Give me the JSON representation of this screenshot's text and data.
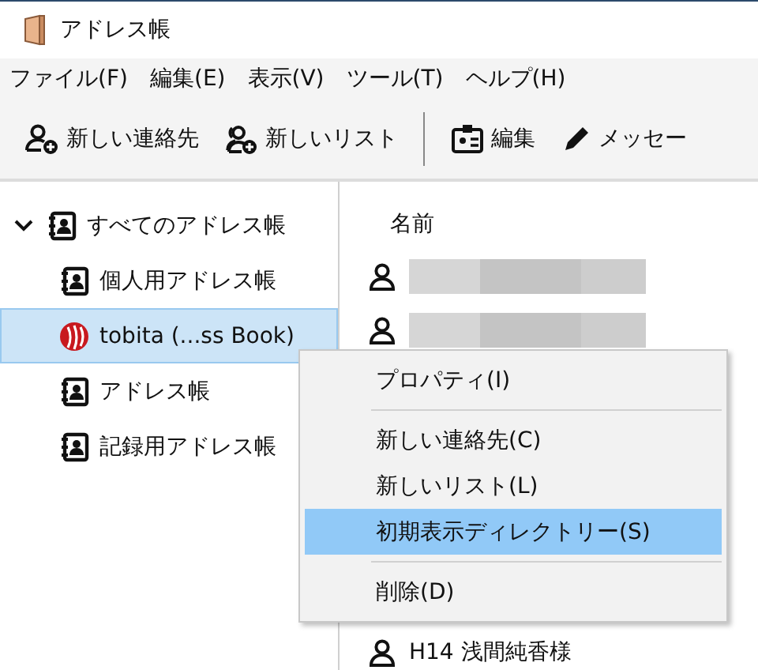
{
  "window": {
    "title": "アドレス帳"
  },
  "menu_bar": [
    "ファイル(F)",
    "編集(E)",
    "表示(V)",
    "ツール(T)",
    "ヘルプ(H)"
  ],
  "toolbar": [
    {
      "kind": "new-contact",
      "label": "新しい連絡先"
    },
    {
      "kind": "new-list",
      "label": "新しいリスト"
    },
    {
      "kind": "separator"
    },
    {
      "kind": "edit",
      "label": "編集"
    },
    {
      "kind": "message",
      "label": "メッセー"
    }
  ],
  "tree": {
    "label": "すべてのアドレス帳",
    "expanded": true,
    "selected": false,
    "children": [
      {
        "kind": "book",
        "label": "個人用アドレス帳",
        "selected": false
      },
      {
        "kind": "remote",
        "label": "tobita (...ss Book)",
        "selected": true
      },
      {
        "kind": "book",
        "label": "アドレス帳",
        "selected": false
      },
      {
        "kind": "book",
        "label": "記録用アドレス帳",
        "selected": false
      }
    ]
  },
  "contacts": {
    "column": "名前",
    "rows": [
      {
        "kind": "blurred"
      },
      {
        "kind": "blurred"
      },
      {
        "kind": "hidden"
      },
      {
        "kind": "hidden"
      },
      {
        "kind": "hidden"
      },
      {
        "kind": "hidden"
      },
      {
        "kind": "hidden"
      },
      {
        "kind": "named",
        "name": "H14 浅間純香様"
      }
    ]
  },
  "context_menu": [
    {
      "kind": "item",
      "label": "プロパティ(I)",
      "selected": false
    },
    {
      "kind": "separator"
    },
    {
      "kind": "item",
      "label": "新しい連絡先(C)",
      "selected": false
    },
    {
      "kind": "item",
      "label": "新しいリスト(L)",
      "selected": false
    },
    {
      "kind": "item",
      "label": "初期表示ディレクトリー(S)",
      "selected": true
    },
    {
      "kind": "separator"
    },
    {
      "kind": "item",
      "label": "削除(D)",
      "selected": false
    }
  ]
}
